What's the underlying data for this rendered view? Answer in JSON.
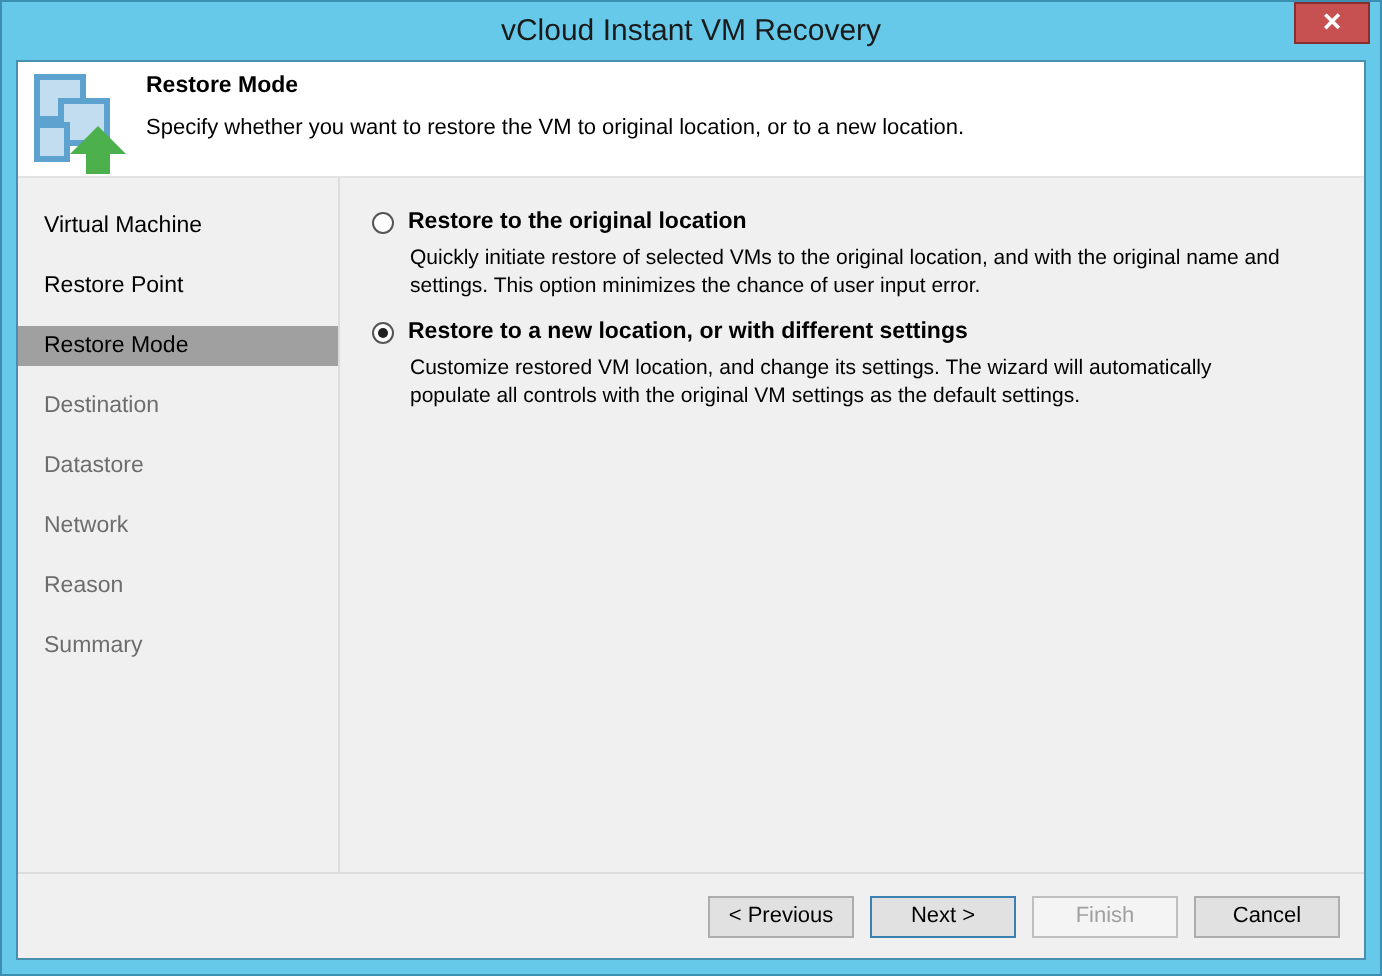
{
  "window": {
    "title": "vCloud Instant VM Recovery",
    "close": "×"
  },
  "header": {
    "title": "Restore Mode",
    "description": "Specify whether you want to restore the VM to original location, or to a new location."
  },
  "sidebar": {
    "items": [
      {
        "label": "Virtual Machine",
        "selected": false,
        "disabled": false
      },
      {
        "label": "Restore Point",
        "selected": false,
        "disabled": false
      },
      {
        "label": "Restore Mode",
        "selected": true,
        "disabled": false
      },
      {
        "label": "Destination",
        "selected": false,
        "disabled": true
      },
      {
        "label": "Datastore",
        "selected": false,
        "disabled": true
      },
      {
        "label": "Network",
        "selected": false,
        "disabled": true
      },
      {
        "label": "Reason",
        "selected": false,
        "disabled": true
      },
      {
        "label": "Summary",
        "selected": false,
        "disabled": true
      }
    ]
  },
  "options": [
    {
      "label": "Restore to the original location",
      "description": "Quickly initiate restore of selected VMs to the original location, and with the original name and settings. This option minimizes the chance of user input error.",
      "selected": false
    },
    {
      "label": "Restore to a new location, or with different settings",
      "description": "Customize restored VM location, and change its settings. The wizard will automatically populate all controls with the original VM settings as the default settings.",
      "selected": true
    }
  ],
  "buttons": [
    {
      "label": "< Previous",
      "disabled": false,
      "default": false
    },
    {
      "label": "Next >",
      "disabled": false,
      "default": true
    },
    {
      "label": "Finish",
      "disabled": true,
      "default": false
    },
    {
      "label": "Cancel",
      "disabled": false,
      "default": false
    }
  ]
}
